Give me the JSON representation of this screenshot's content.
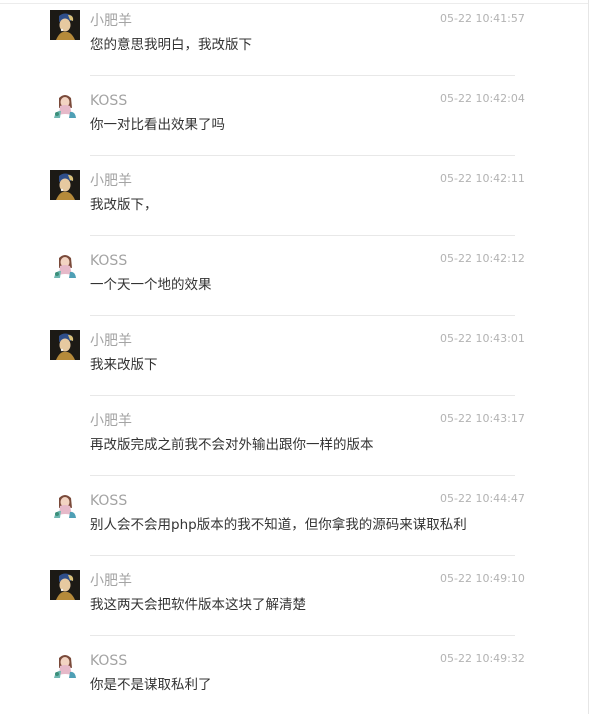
{
  "messages": [
    {
      "name": "小肥羊",
      "time": "05-22 10:41:57",
      "text": "您的意思我明白，我改版下",
      "avatar": "pearl-earring-portrait-icon"
    },
    {
      "name": "KOSS",
      "time": "05-22 10:42:04",
      "text": "你一对比看出效果了吗",
      "avatar": "cartoon-girl-avatar-icon"
    },
    {
      "name": "小肥羊",
      "time": "05-22 10:42:11",
      "text": "我改版下，",
      "avatar": "pearl-earring-portrait-icon"
    },
    {
      "name": "KOSS",
      "time": "05-22 10:42:12",
      "text": "一个天一个地的效果",
      "avatar": "cartoon-girl-avatar-icon"
    },
    {
      "name": "小肥羊",
      "time": "05-22 10:43:01",
      "text": "我来改版下",
      "avatar": "pearl-earring-portrait-icon"
    },
    {
      "name": "小肥羊",
      "time": "05-22 10:43:17",
      "text": "再改版完成之前我不会对外输出跟你一样的版本",
      "avatar": ""
    },
    {
      "name": "KOSS",
      "time": "05-22 10:44:47",
      "text": "别人会不会用php版本的我不知道，但你拿我的源码来谋取私利",
      "avatar": "cartoon-girl-avatar-icon"
    },
    {
      "name": "小肥羊",
      "time": "05-22 10:49:10",
      "text": "我这两天会把软件版本这块了解清楚",
      "avatar": "pearl-earring-portrait-icon"
    },
    {
      "name": "KOSS",
      "time": "05-22 10:49:32",
      "text": "你是不是谋取私利了",
      "avatar": "cartoon-girl-avatar-icon"
    }
  ],
  "colors": {
    "name": "#a3a3a3",
    "time": "#b3b3b3",
    "text": "#333333",
    "separator": "#e8e8e8"
  }
}
